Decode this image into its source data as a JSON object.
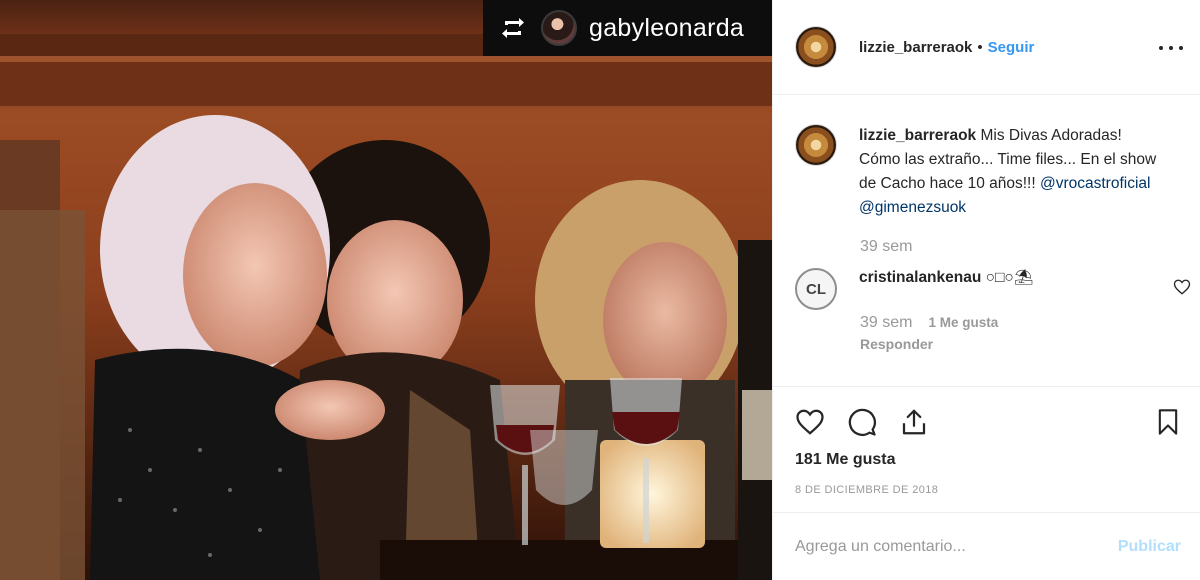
{
  "photo": {
    "repost_user": "gabyleonarda",
    "repost_icon": "repost-icon"
  },
  "post": {
    "author": "lizzie_barreraok",
    "dot": "•",
    "follow_label": "Seguir",
    "more_icon": "more-icon"
  },
  "caption": {
    "user": "lizzie_barreraok",
    "text": "Mis Divas Adoradas! Cómo las extraño... Time files... En el show de Cacho hace 10 años!!!",
    "mentions": [
      "@vrocastroficial",
      "@gimenezsuok"
    ],
    "time": "39 sem"
  },
  "comment": {
    "avatar_text": "CL",
    "user": "cristinalankenau",
    "text": "○□○⛱",
    "time": "39 sem",
    "likes": "1 Me gusta",
    "reply_label": "Responder"
  },
  "actions": {
    "likes": "181 Me gusta",
    "date": "8 DE DICIEMBRE DE 2018"
  },
  "add_comment": {
    "placeholder": "Agrega un comentario...",
    "publish_label": "Publicar"
  },
  "colors": {
    "link": "#3897f0",
    "mention": "#003569",
    "publish_disabled": "#b2dffc",
    "muted": "#999999"
  }
}
